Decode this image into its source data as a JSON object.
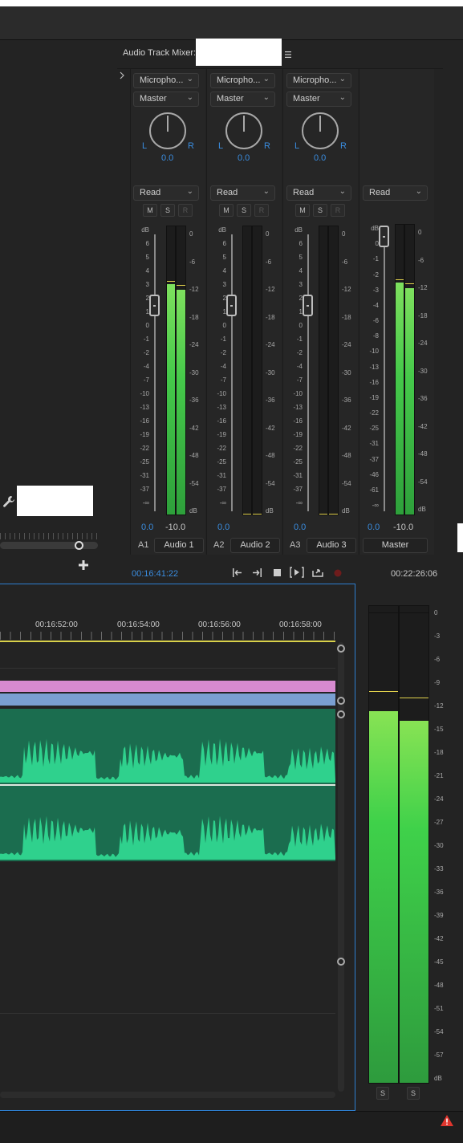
{
  "mixer": {
    "title": "Audio Track Mixer:",
    "menu_icon": "hamburger-icon",
    "expand_icon": "chevron-right-icon",
    "timecode_current": "00:16:41:22",
    "timecode_duration": "00:22:26:06",
    "strips": [
      {
        "input": "Micropho...",
        "output": "Master",
        "pan_l": "L",
        "pan_r": "R",
        "pan_value": "0.0",
        "mode": "Read",
        "m": "M",
        "s": "S",
        "r": "R",
        "volume": "0.0",
        "peak": "-10.0",
        "track_id": "A1",
        "track_name": "Audio 1",
        "left_level": 0.8,
        "right_level": 0.78
      },
      {
        "input": "Micropho...",
        "output": "Master",
        "pan_l": "L",
        "pan_r": "R",
        "pan_value": "0.0",
        "mode": "Read",
        "m": "M",
        "s": "S",
        "r": "R",
        "volume": "0.0",
        "peak": "",
        "track_id": "A2",
        "track_name": "Audio 2",
        "left_level": 0.0,
        "right_level": 0.0
      },
      {
        "input": "Micropho...",
        "output": "Master",
        "pan_l": "L",
        "pan_r": "R",
        "pan_value": "0.0",
        "mode": "Read",
        "m": "M",
        "s": "S",
        "r": "R",
        "volume": "0.0",
        "peak": "",
        "track_id": "A3",
        "track_name": "Audio 3",
        "left_level": 0.0,
        "right_level": 0.0
      },
      {
        "input": "",
        "output": "",
        "mode": "Read",
        "volume": "0.0",
        "peak": "-10.0",
        "track_id": "",
        "track_name": "Master",
        "left_level": 0.8,
        "right_level": 0.78
      }
    ],
    "fader_scale": [
      "dB",
      "6",
      "5",
      "4",
      "3",
      "2",
      "1",
      "0",
      "-1",
      "-2",
      "-4",
      "-7",
      "-10",
      "-13",
      "-16",
      "-19",
      "-22",
      "-25",
      "-31",
      "-37",
      "-∞"
    ],
    "master_fader_scale": [
      "dB",
      "0",
      "-1",
      "-2",
      "-3",
      "-4",
      "-6",
      "-8",
      "-10",
      "-13",
      "-16",
      "-19",
      "-22",
      "-25",
      "-31",
      "-37",
      "-46",
      "-61",
      "-∞"
    ],
    "meter_scale": [
      "0",
      "-6",
      "-12",
      "-18",
      "-24",
      "-30",
      "-36",
      "-42",
      "-48",
      "-54",
      "dB"
    ],
    "transport_icons": [
      "go-to-in-icon",
      "go-to-out-icon",
      "stop-icon",
      "play-in-to-out-icon",
      "loop-icon",
      "record-icon"
    ]
  },
  "timeline": {
    "ruler_labels": [
      "00:16:52:00",
      "00:16:54:00",
      "00:16:56:00",
      "00:16:58:00"
    ],
    "add_icon": "plus-icon",
    "wrench_icon": "wrench-icon"
  },
  "master_meter": {
    "scale": [
      "0",
      "-3",
      "-6",
      "-9",
      "-12",
      "-15",
      "-18",
      "-21",
      "-24",
      "-27",
      "-30",
      "-33",
      "-36",
      "-39",
      "-42",
      "-45",
      "-48",
      "-51",
      "-54",
      "-57",
      "dB"
    ],
    "solo_left": "S",
    "solo_right": "S",
    "left_level": 0.78,
    "right_level": 0.76
  },
  "status": {
    "warning_icon": "warning-icon"
  }
}
